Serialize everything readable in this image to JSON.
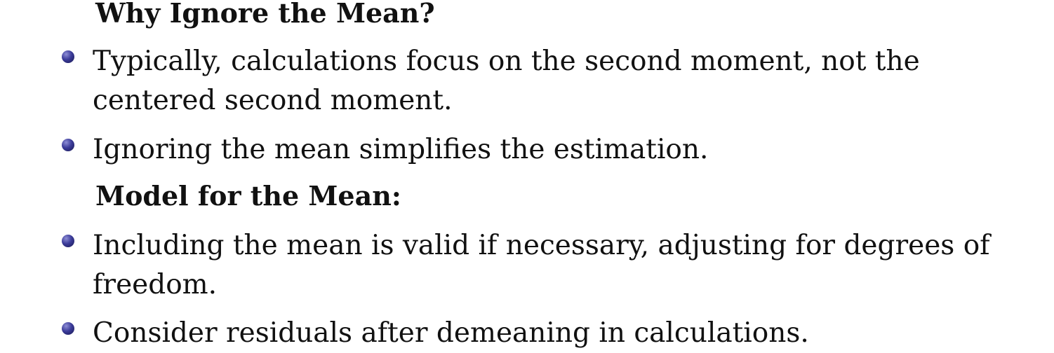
{
  "sections": [
    {
      "heading": "Why Ignore the Mean?",
      "bullets": [
        "Typically, calculations focus on the second moment, not the centered second moment.",
        "Ignoring the mean simplifies the estimation."
      ]
    },
    {
      "heading": "Model for the Mean:",
      "bullets": [
        "Including the mean is valid if necessary, adjusting for degrees of freedom.",
        "Consider residuals after demeaning in calculations."
      ]
    }
  ]
}
